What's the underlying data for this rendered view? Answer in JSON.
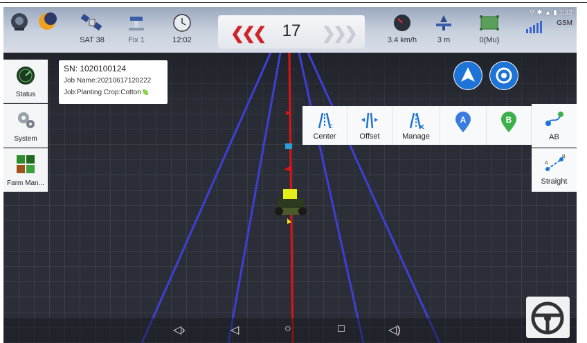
{
  "status_bar": {
    "satellites": {
      "label": "SAT 38",
      "icon": "satellite-icon"
    },
    "fix": {
      "label": "Fix 1",
      "icon": "gps-fix-icon"
    },
    "time": {
      "label": "12:02",
      "icon": "clock-icon"
    },
    "line_number": "17",
    "speed": {
      "label": "3.4 km/h",
      "icon": "speedometer-icon"
    },
    "distance": {
      "label": "3 m",
      "icon": "offset-distance-icon"
    },
    "area": {
      "label": "0(Mu)",
      "icon": "area-icon"
    },
    "android_time": "1:32",
    "network": "GSM"
  },
  "info_card": {
    "sn": "SN: 1020100124",
    "job_name": "Job Name:20210617120222",
    "job_crop": "Job:Planting  Crop:Cotton"
  },
  "left_nav": {
    "items": [
      {
        "label": "Status",
        "icon": "status-gauge-icon"
      },
      {
        "label": "System",
        "icon": "gear-icon"
      },
      {
        "label": "Farm Man...",
        "icon": "farm-field-icon"
      }
    ]
  },
  "toolbar": {
    "center": "Center",
    "offset": "Offset",
    "manage": "Manage",
    "point_a": "A",
    "point_b": "B"
  },
  "right_panel": {
    "ab": "AB",
    "straight": "Straight",
    "straight_point_a": "A",
    "straight_point_b": "B"
  },
  "colors": {
    "guide_red": "#e01414",
    "guide_blue": "#3f3fd8",
    "accent_blue": "#1e73d6",
    "point_a": "#3a7be0",
    "point_b": "#3cb04a",
    "reverse_arrows": "#d1232a"
  }
}
